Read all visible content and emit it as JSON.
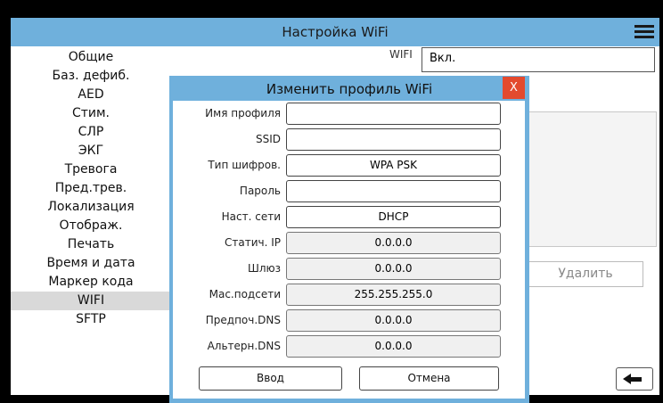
{
  "header": {
    "title": "Настройка WiFi"
  },
  "sidebar": {
    "items": [
      {
        "label": "Общие"
      },
      {
        "label": "Баз. дефиб."
      },
      {
        "label": "AED"
      },
      {
        "label": "Стим."
      },
      {
        "label": "СЛР"
      },
      {
        "label": "ЭКГ"
      },
      {
        "label": "Тревога"
      },
      {
        "label": "Пред.трев."
      },
      {
        "label": "Локализация"
      },
      {
        "label": "Отображ."
      },
      {
        "label": "Печать"
      },
      {
        "label": "Время и дата"
      },
      {
        "label": "Маркер кода"
      },
      {
        "label": "WIFI"
      },
      {
        "label": "SFTP"
      }
    ],
    "active_index": 13
  },
  "background": {
    "wifi_label_partial": "WIFI",
    "wifi_value": "Вкл.",
    "delete_label": "Удалить"
  },
  "dialog": {
    "title": "Изменить профиль WiFi",
    "close_label": "X",
    "fields": [
      {
        "label": "Имя профиля",
        "value": "",
        "disabled": false
      },
      {
        "label": "SSID",
        "value": "",
        "disabled": false
      },
      {
        "label": "Тип шифров.",
        "value": "WPA PSK",
        "disabled": false
      },
      {
        "label": "Пароль",
        "value": "",
        "disabled": false
      },
      {
        "label": "Наст. сети",
        "value": "DHCP",
        "disabled": false
      },
      {
        "label": "Статич. IP",
        "value": "0.0.0.0",
        "disabled": true
      },
      {
        "label": "Шлюз",
        "value": "0.0.0.0",
        "disabled": true
      },
      {
        "label": "Мас.подсети",
        "value": "255.255.255.0",
        "disabled": true
      },
      {
        "label": "Предпоч.DNS",
        "value": "0.0.0.0",
        "disabled": true
      },
      {
        "label": "Альтерн.DNS",
        "value": "0.0.0.0",
        "disabled": true
      }
    ],
    "ok_label": "Ввод",
    "cancel_label": "Отмена"
  },
  "colors": {
    "accent": "#6fb0dc",
    "close": "#e34a2e"
  }
}
